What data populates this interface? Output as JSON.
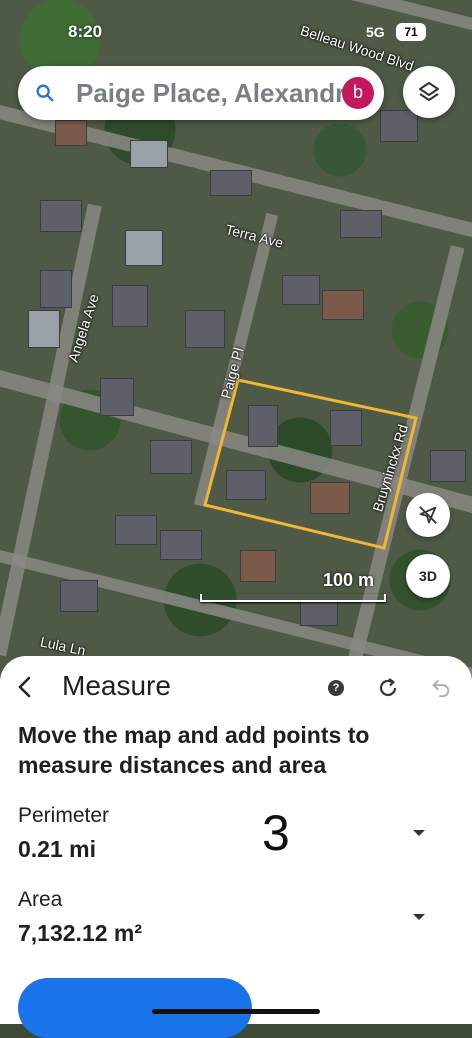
{
  "status_bar": {
    "time": "8:20",
    "network": "5G",
    "battery": "71"
  },
  "search": {
    "text": "Paige Place, Alexandria",
    "avatar_letter": "b"
  },
  "map": {
    "streets": [
      "Belleau Wood Blvd",
      "Terra Ave",
      "Angela Ave",
      "Paige Pl",
      "Bruyninckx Rd",
      "Lula Ln"
    ],
    "scale_label": "100 m",
    "button_3d": "3D",
    "measure_outline_color": "#f2b632"
  },
  "measure": {
    "title": "Measure",
    "instruction": "Move the map and add points to measure distances and area",
    "perimeter_label": "Perimeter",
    "perimeter_value": "0.21 mi",
    "area_label": "Area",
    "area_value": "7,132.12 m²",
    "points_count": "3"
  },
  "colors": {
    "accent": "#1a73e8",
    "avatar": "#c2185b"
  }
}
